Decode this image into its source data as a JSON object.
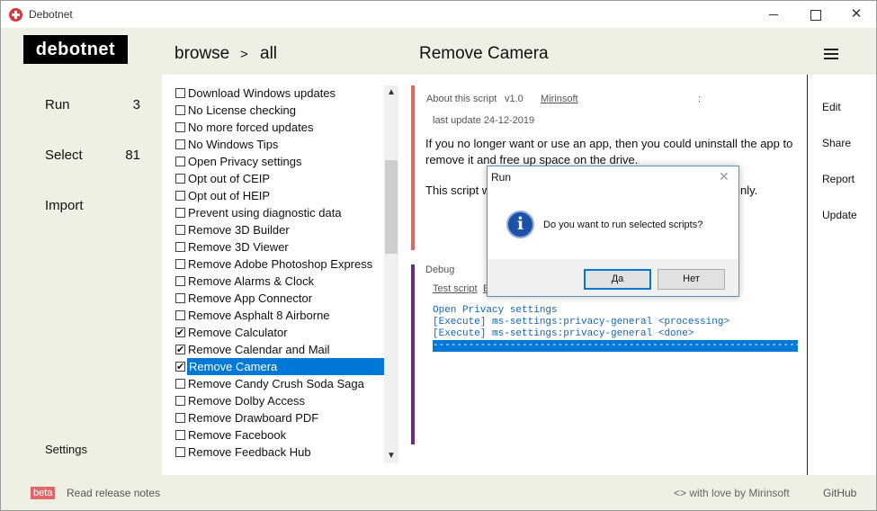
{
  "window": {
    "title": "Debotnet"
  },
  "header": {
    "logo": "debotnet",
    "breadcrumb": [
      "browse",
      ">",
      "all"
    ],
    "page_title": "Remove Camera"
  },
  "leftnav": {
    "run_label": "Run",
    "run_count": "3",
    "select_label": "Select",
    "select_count": "81",
    "import_label": "Import",
    "settings_label": "Settings"
  },
  "scripts": [
    {
      "label": "Download Windows updates",
      "checked": false,
      "selected": false
    },
    {
      "label": "No License checking",
      "checked": false,
      "selected": false
    },
    {
      "label": "No more forced updates",
      "checked": false,
      "selected": false
    },
    {
      "label": "No Windows Tips",
      "checked": false,
      "selected": false
    },
    {
      "label": "Open Privacy settings",
      "checked": false,
      "selected": false
    },
    {
      "label": "Opt out of CEIP",
      "checked": false,
      "selected": false
    },
    {
      "label": "Opt out of HEIP",
      "checked": false,
      "selected": false
    },
    {
      "label": "Prevent using diagnostic data",
      "checked": false,
      "selected": false
    },
    {
      "label": "Remove 3D Builder",
      "checked": false,
      "selected": false
    },
    {
      "label": "Remove 3D Viewer",
      "checked": false,
      "selected": false
    },
    {
      "label": "Remove Adobe Photoshop Express",
      "checked": false,
      "selected": false
    },
    {
      "label": "Remove Alarms & Clock",
      "checked": false,
      "selected": false
    },
    {
      "label": "Remove App Connector",
      "checked": false,
      "selected": false
    },
    {
      "label": "Remove Asphalt 8 Airborne",
      "checked": false,
      "selected": false
    },
    {
      "label": "Remove Calculator",
      "checked": true,
      "selected": false
    },
    {
      "label": "Remove Calendar and Mail",
      "checked": true,
      "selected": false
    },
    {
      "label": "Remove Camera",
      "checked": true,
      "selected": true
    },
    {
      "label": "Remove Candy Crush Soda Saga",
      "checked": false,
      "selected": false
    },
    {
      "label": "Remove Dolby Access",
      "checked": false,
      "selected": false
    },
    {
      "label": "Remove Drawboard PDF",
      "checked": false,
      "selected": false
    },
    {
      "label": "Remove Facebook",
      "checked": false,
      "selected": false
    },
    {
      "label": "Remove Feedback Hub",
      "checked": false,
      "selected": false
    }
  ],
  "about": {
    "label": "About this script",
    "version": "v1.0",
    "author": "Mirinsoft",
    "colon": ":",
    "last_update": "last update 24-12-2019",
    "description": "If you no longer want or use an app, then you could uninstall the app to remove it and free up space on the drive.",
    "description2_start": "This script w",
    "description2_end": "nly."
  },
  "debug": {
    "label": "Debug",
    "test_script": "Test script",
    "second_link": "E",
    "console_lines": [
      "Open Privacy settings",
      "[Execute] ms-settings:privacy-general <processing>",
      "[Execute] ms-settings:privacy-general <done>"
    ],
    "console_bar": "-----------------------------------------------------------------"
  },
  "actions": {
    "edit": "Edit",
    "share": "Share",
    "report": "Report",
    "update": "Update"
  },
  "footer": {
    "beta": "beta",
    "release_notes": "Read release notes",
    "love": "<> with love by Mirinsoft",
    "github": "GitHub"
  },
  "dialog": {
    "title": "Run",
    "close": "✕",
    "icon": "i",
    "message": "Do you want to run selected scripts?",
    "yes": "Да",
    "no": "Нет"
  },
  "colors": {
    "accent_red": "#e06767",
    "accent_purple": "#6b2a86",
    "selection": "#0078d7",
    "header_bg": "#f0efe3"
  }
}
